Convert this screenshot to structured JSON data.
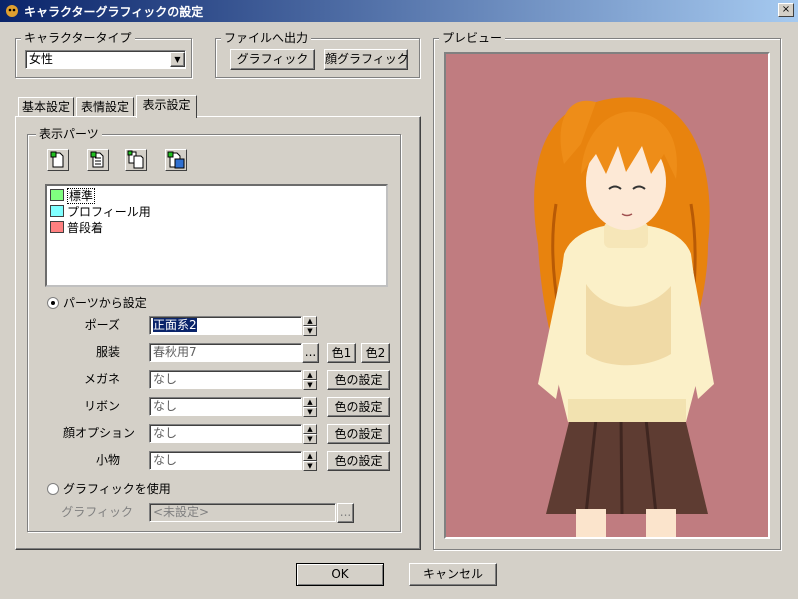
{
  "window": {
    "title": "キャラクターグラフィックの設定",
    "close_label": "×"
  },
  "character_type": {
    "legend": "キャラクタータイプ",
    "selected": "女性"
  },
  "file_output": {
    "legend": "ファイルへ出力",
    "graphic_button": "グラフィック",
    "face_button": "顔グラフィック"
  },
  "tabs": [
    {
      "label": "基本設定"
    },
    {
      "label": "表情設定"
    },
    {
      "label": "表示設定"
    }
  ],
  "display_parts": {
    "legend": "表示パーツ",
    "toolbar_icons": [
      "new-document-icon",
      "edit-document-icon",
      "copy-document-icon",
      "delete-document-icon"
    ],
    "items": [
      {
        "label": "標準",
        "color": "#80ff80"
      },
      {
        "label": "プロフィール用",
        "color": "#80ffff"
      },
      {
        "label": "普段着",
        "color": "#ff8080"
      }
    ]
  },
  "set_from_parts": {
    "label": "パーツから設定",
    "rows": [
      {
        "label": "ポーズ",
        "value": "正面系2"
      },
      {
        "label": "服装",
        "value": "春秋用7",
        "color1": "色1",
        "color2": "色2"
      },
      {
        "label": "メガネ",
        "value": "なし",
        "button": "色の設定"
      },
      {
        "label": "リボン",
        "value": "なし",
        "button": "色の設定"
      },
      {
        "label": "顔オプション",
        "value": "なし",
        "button": "色の設定"
      },
      {
        "label": "小物",
        "value": "なし",
        "button": "色の設定"
      }
    ],
    "browse": "..."
  },
  "use_graphic": {
    "label": "グラフィックを使用",
    "field_label": "グラフィック",
    "value": "<未設定>",
    "browse": "..."
  },
  "preview": {
    "legend": "プレビュー",
    "background": "#c07c80"
  },
  "footer": {
    "ok": "OK",
    "cancel": "キャンセル"
  }
}
